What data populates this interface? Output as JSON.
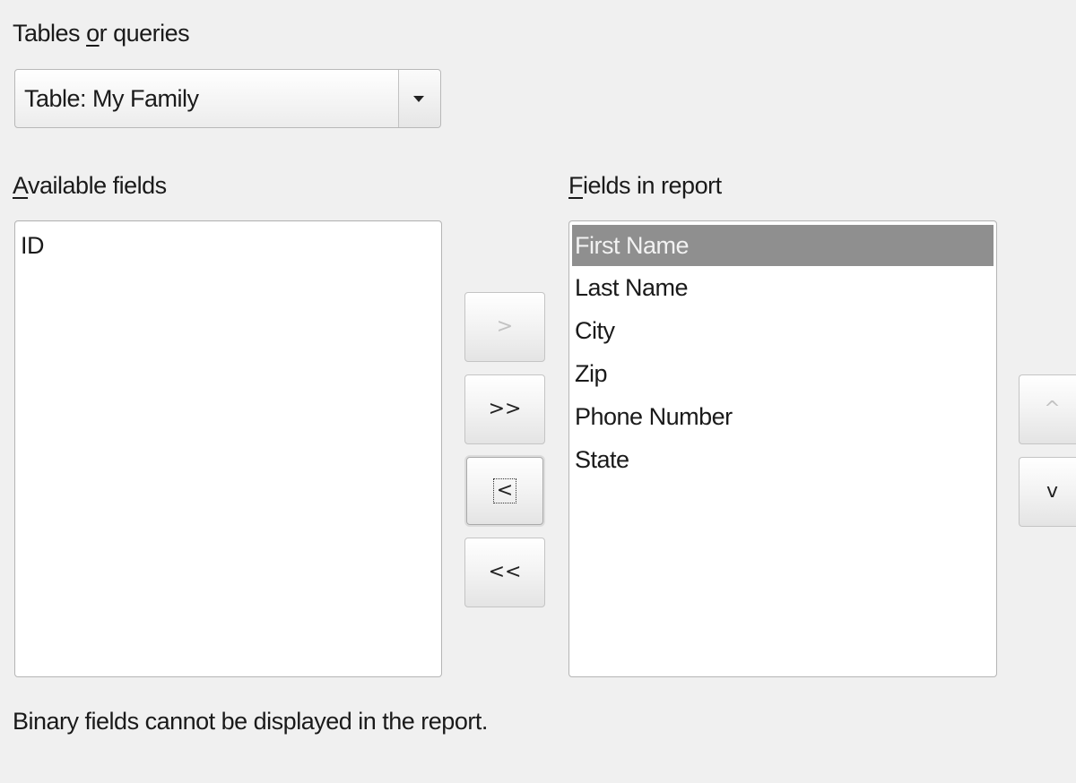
{
  "tables_or_queries": {
    "label_pre": "Tables ",
    "label_mnemonic": "o",
    "label_post": "r queries",
    "selected": "Table: My Family",
    "dropdown_icon": "triangle-down-icon"
  },
  "available_fields": {
    "label_mnemonic": "A",
    "label_rest": "vailable fields",
    "items": [
      "ID"
    ]
  },
  "fields_in_report": {
    "label_mnemonic": "F",
    "label_rest": "ields in report",
    "items": [
      "First Name",
      "Last Name",
      "City",
      "Zip",
      "Phone Number",
      "State"
    ],
    "selected_index": 0
  },
  "transfer_buttons": {
    "add_one": ">",
    "add_all": ">>",
    "remove_one": "<",
    "remove_all": "<<"
  },
  "order_buttons": {
    "move_up": "^",
    "move_down": "v"
  },
  "footer": {
    "note": "Binary fields cannot be displayed in the report."
  }
}
